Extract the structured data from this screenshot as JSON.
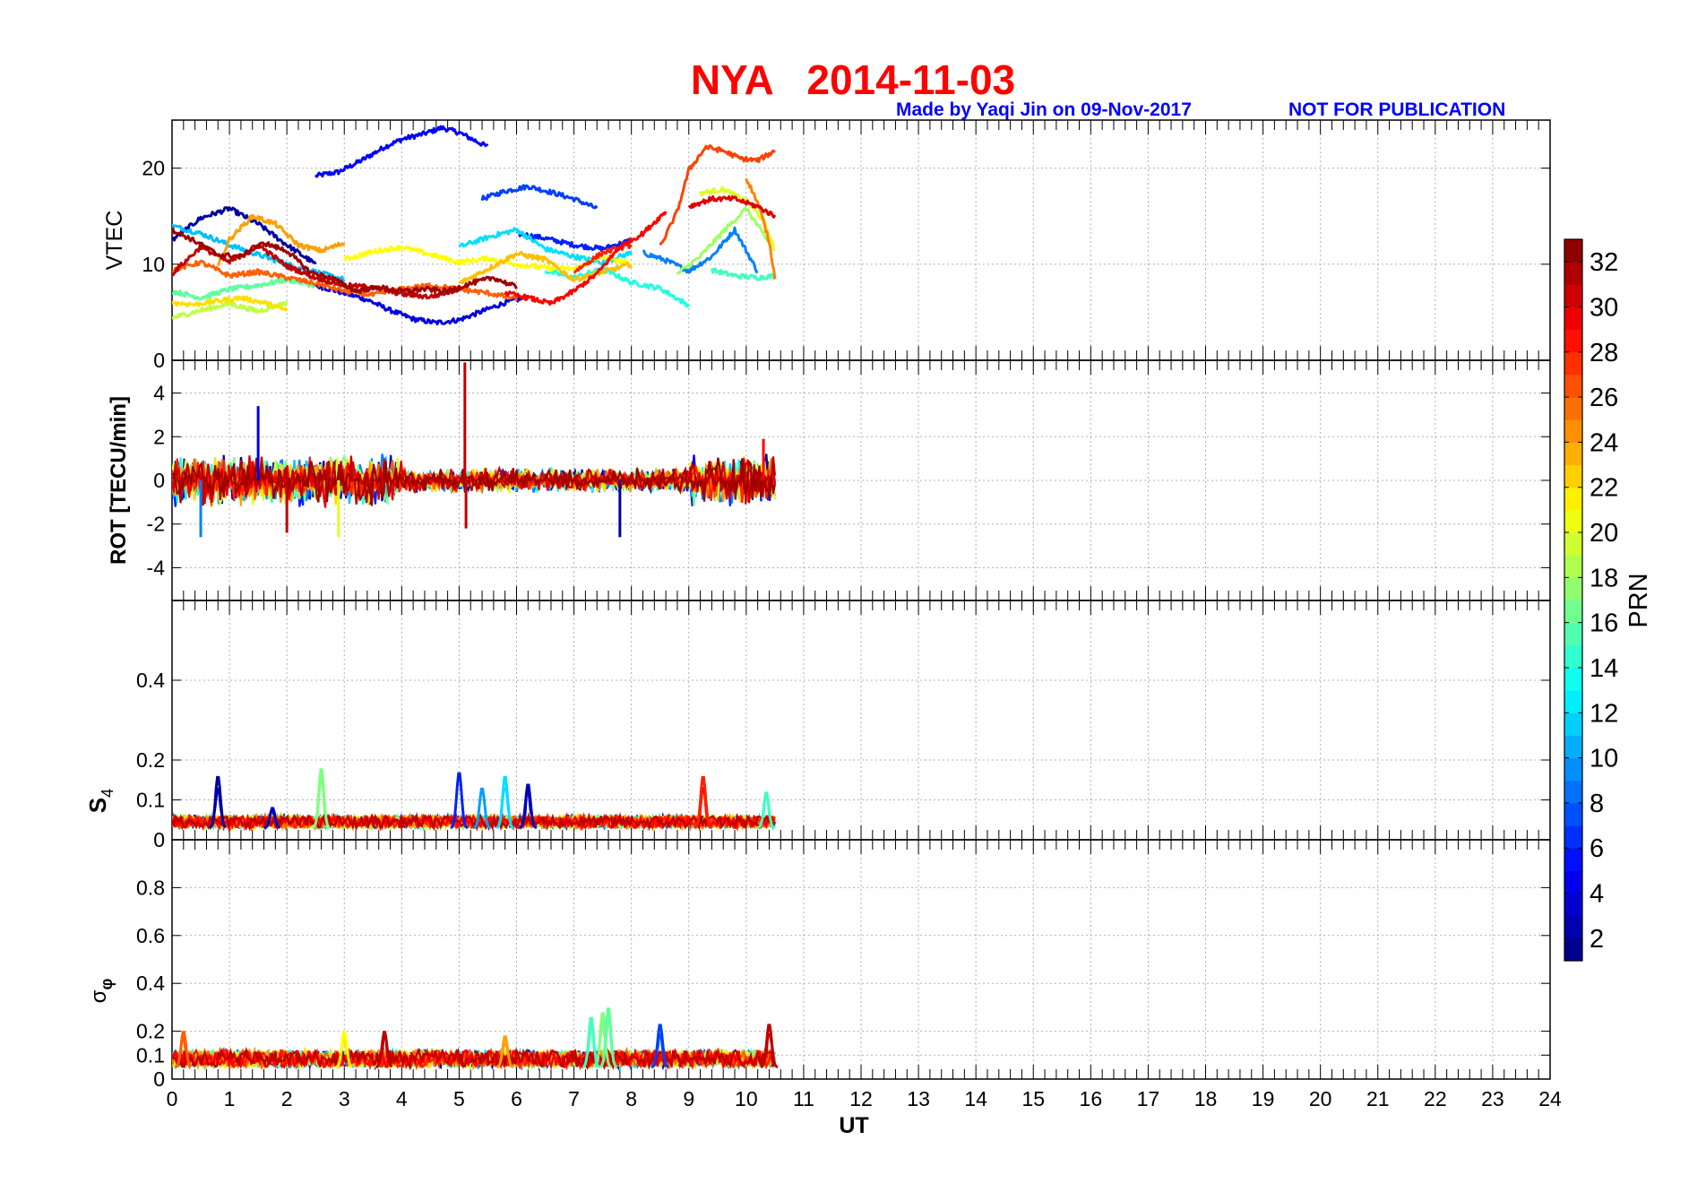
{
  "header": {
    "title": "NYA   2014-11-03",
    "credit": "Made by Yaqi Jin on 09-Nov-2017",
    "notice": "NOT FOR PUBLICATION"
  },
  "colors": {
    "title": "#ff0000",
    "credit": "#0000ff",
    "axis": "#000000",
    "grid": "#b0b0b0"
  },
  "chart_data": {
    "type": "line",
    "colormap": "jet",
    "x": {
      "label": "UT",
      "range": [
        0,
        24
      ],
      "ticks": [
        0,
        1,
        2,
        3,
        4,
        5,
        6,
        7,
        8,
        9,
        10,
        11,
        12,
        13,
        14,
        15,
        16,
        17,
        18,
        19,
        20,
        21,
        22,
        23,
        24
      ],
      "tick_labels": [
        "0",
        "1",
        "2",
        "3",
        "4",
        "5",
        "6",
        "7",
        "8",
        "9",
        "10",
        "11",
        "12",
        "13",
        "14",
        "15",
        "16",
        "17",
        "18",
        "19",
        "20",
        "21",
        "22",
        "23",
        "24"
      ],
      "data_coverage_ut": [
        0,
        10.5
      ]
    },
    "panels": [
      {
        "id": "vtec",
        "ylabel": "VTEC",
        "ylim": [
          0,
          25
        ],
        "ticks": [
          0,
          10,
          20
        ],
        "tick_labels": [
          "0",
          "10",
          "20"
        ],
        "series": [
          {
            "prn": 5,
            "x": [
              2.5,
              2.9,
              3.3,
              3.7,
              4.0,
              4.4,
              4.7,
              5.0,
              5.3,
              5.5
            ],
            "y": [
              19.2,
              19.6,
              20.8,
              22.2,
              23.0,
              23.6,
              24.2,
              23.7,
              22.8,
              22.2
            ]
          },
          {
            "prn": 4,
            "x": [
              2.5,
              3.0,
              3.4,
              3.8,
              4.2,
              4.6,
              5.0,
              5.4,
              5.8,
              6.2
            ],
            "y": [
              7.8,
              7.0,
              6.3,
              5.2,
              4.3,
              3.9,
              4.2,
              5.1,
              6.0,
              6.6
            ]
          },
          {
            "prn": 7,
            "x": [
              5.4,
              5.8,
              6.2,
              6.6,
              7.0,
              7.4
            ],
            "y": [
              16.8,
              17.6,
              18.1,
              17.5,
              16.8,
              15.8
            ]
          },
          {
            "prn": 6,
            "x": [
              6.0,
              6.5,
              7.0,
              7.5,
              8.0
            ],
            "y": [
              13.2,
              12.7,
              12.0,
              11.6,
              12.5
            ]
          },
          {
            "prn": 2,
            "x": [
              0,
              0.5,
              1.0,
              1.5,
              2.0,
              2.5
            ],
            "y": [
              12.5,
              14.8,
              15.8,
              14.2,
              12.0,
              10.0
            ]
          },
          {
            "prn": 9,
            "x": [
              8.2,
              8.6,
              9.0,
              9.4,
              9.8,
              10.2
            ],
            "y": [
              11.2,
              10.4,
              9.3,
              10.8,
              13.6,
              9.2
            ]
          },
          {
            "prn": 11,
            "x": [
              0,
              0.5,
              1.0,
              1.5,
              2.0,
              2.5,
              3.0
            ],
            "y": [
              14.0,
              13.2,
              12.0,
              11.0,
              10.0,
              9.2,
              8.4
            ]
          },
          {
            "prn": 12,
            "x": [
              5.0,
              5.5,
              6.0,
              6.5,
              7.0,
              7.5,
              8.0
            ],
            "y": [
              11.8,
              12.8,
              13.6,
              11.6,
              10.8,
              10.2,
              11.2
            ]
          },
          {
            "prn": 14,
            "x": [
              6.5,
              7.0,
              7.5,
              8.0,
              8.5,
              9.0
            ],
            "y": [
              9.3,
              8.6,
              9.5,
              8.1,
              7.5,
              5.7
            ]
          },
          {
            "prn": 15,
            "x": [
              9.4,
              9.8,
              10.2,
              10.5
            ],
            "y": [
              9.4,
              8.8,
              8.6,
              8.8
            ]
          },
          {
            "prn": 16,
            "x": [
              0,
              0.5,
              1.0,
              1.5,
              2.0,
              2.5
            ],
            "y": [
              7.2,
              6.5,
              7.4,
              7.8,
              8.4,
              7.8
            ]
          },
          {
            "prn": 18,
            "x": [
              8.8,
              9.2,
              9.6,
              10.0,
              10.4
            ],
            "y": [
              9.0,
              10.8,
              13.4,
              15.8,
              12.2
            ]
          },
          {
            "prn": 19,
            "x": [
              0,
              0.5,
              1.0,
              1.5,
              2.0
            ],
            "y": [
              4.4,
              5.2,
              5.9,
              5.1,
              6.0
            ]
          },
          {
            "prn": 20,
            "x": [
              9.2,
              9.6,
              10.0,
              10.3,
              10.5
            ],
            "y": [
              17.4,
              17.8,
              16.6,
              14.6,
              11.4
            ]
          },
          {
            "prn": 21,
            "x": [
              3.0,
              3.5,
              4.0,
              4.5,
              5.0,
              5.5,
              6.0,
              6.5,
              7.0,
              7.5,
              8.0
            ],
            "y": [
              10.5,
              11.3,
              11.8,
              11.0,
              10.2,
              10.6,
              10.0,
              9.6,
              9.5,
              10.8,
              10.0
            ]
          },
          {
            "prn": 22,
            "x": [
              0,
              0.4,
              0.8,
              1.2,
              1.6,
              2.0
            ],
            "y": [
              6.0,
              5.8,
              6.2,
              6.5,
              6.0,
              5.2
            ]
          },
          {
            "prn": 23,
            "x": [
              5.0,
              5.5,
              6.0,
              6.5,
              7.0,
              7.5,
              8.0
            ],
            "y": [
              8.0,
              9.5,
              11.1,
              10.5,
              8.4,
              9.2,
              10.0
            ]
          },
          {
            "prn": 24,
            "x": [
              0.8,
              1.0,
              1.4,
              1.8,
              2.2,
              2.6,
              3.0
            ],
            "y": [
              9.8,
              12.6,
              15.0,
              14.2,
              12.0,
              11.4,
              12.2
            ]
          },
          {
            "prn": 25,
            "x": [
              10.0,
              10.2,
              10.4,
              10.5
            ],
            "y": [
              19.0,
              16.4,
              12.4,
              8.6
            ]
          },
          {
            "prn": 26,
            "x": [
              0,
              0.5,
              1.0,
              1.5,
              2.0,
              2.5,
              3.0,
              3.5,
              4.0,
              4.5,
              5.0,
              5.5,
              6.0
            ],
            "y": [
              9.4,
              10.2,
              8.8,
              9.2,
              8.6,
              8.0,
              7.2,
              6.8,
              7.4,
              7.8,
              7.4,
              7.0,
              6.4
            ]
          },
          {
            "prn": 27,
            "x": [
              8.5,
              8.8,
              9.0,
              9.3,
              9.6,
              9.9,
              10.2,
              10.5
            ],
            "y": [
              11.8,
              15.5,
              19.8,
              22.2,
              21.8,
              21.0,
              20.8,
              21.8
            ]
          },
          {
            "prn": 28,
            "x": [
              7.0,
              7.5,
              8.0
            ],
            "y": [
              9.2,
              11.2,
              12.0
            ]
          },
          {
            "prn": 29,
            "x": [
              5.8,
              6.2,
              6.6,
              7.0,
              7.4,
              7.8,
              8.2,
              8.6
            ],
            "y": [
              7.0,
              6.5,
              5.9,
              7.2,
              9.0,
              11.8,
              13.2,
              15.5
            ]
          },
          {
            "prn": 30,
            "x": [
              9.0,
              9.4,
              9.8,
              10.2,
              10.5
            ],
            "y": [
              16.0,
              16.8,
              16.8,
              16.0,
              15.0
            ]
          },
          {
            "prn": 31,
            "x": [
              0,
              0.5,
              1.0,
              1.5,
              2.0,
              2.5,
              3.0,
              3.5,
              4.0,
              4.5,
              5.0
            ],
            "y": [
              9.0,
              11.8,
              10.2,
              12.0,
              9.8,
              8.6,
              7.8,
              7.6,
              6.9,
              6.6,
              7.4
            ]
          },
          {
            "prn": 32,
            "x": [
              0,
              0.4,
              0.8,
              1.2,
              1.6,
              2.0,
              2.4,
              2.8,
              3.2,
              3.6,
              4.0,
              4.4,
              4.8,
              5.2,
              5.6,
              6.0
            ],
            "y": [
              13.6,
              12.4,
              11.0,
              10.8,
              12.2,
              11.4,
              9.2,
              8.5,
              7.2,
              7.6,
              7.2,
              7.4,
              7.2,
              8.0,
              8.6,
              7.6
            ]
          }
        ]
      },
      {
        "id": "rot",
        "ylabel": "ROT [TECU/min]",
        "ylim": [
          -5.5,
          5.5
        ],
        "ticks": [
          -4,
          -2,
          0,
          2,
          4
        ],
        "tick_labels": [
          "-4",
          "-2",
          "0",
          "2",
          "4"
        ],
        "spikes": [
          {
            "prn": 31,
            "x": 5.1,
            "y": 5.4
          },
          {
            "prn": 31,
            "x": 5.12,
            "y": -2.2
          },
          {
            "prn": 4,
            "x": 1.5,
            "y": 3.4
          },
          {
            "prn": 9,
            "x": 0.5,
            "y": -2.6
          },
          {
            "prn": 2,
            "x": 7.8,
            "y": -2.6
          },
          {
            "prn": 20,
            "x": 2.9,
            "y": -2.6
          },
          {
            "prn": 31,
            "x": 2.0,
            "y": -2.4
          },
          {
            "prn": 29,
            "x": 10.3,
            "y": 1.9
          }
        ]
      },
      {
        "id": "s4",
        "ylabel": "S4",
        "ylim": [
          0,
          0.6
        ],
        "ticks": [
          0,
          0.1,
          0.2,
          0.4
        ],
        "tick_labels": [
          "0",
          "0.1",
          "0.2",
          "0.4"
        ],
        "baseline": [
          0.03,
          0.06
        ],
        "peaks": [
          {
            "prn": 2,
            "x": 0.8,
            "y": 0.16
          },
          {
            "prn": 17,
            "x": 2.6,
            "y": 0.18
          },
          {
            "prn": 6,
            "x": 5.0,
            "y": 0.17
          },
          {
            "prn": 10,
            "x": 5.4,
            "y": 0.13
          },
          {
            "prn": 12,
            "x": 5.8,
            "y": 0.16
          },
          {
            "prn": 3,
            "x": 6.2,
            "y": 0.14
          },
          {
            "prn": 28,
            "x": 9.25,
            "y": 0.16
          },
          {
            "prn": 15,
            "x": 10.35,
            "y": 0.12
          },
          {
            "prn": 3,
            "x": 1.75,
            "y": 0.08
          }
        ]
      },
      {
        "id": "sigma_phi",
        "ylabel": "σφ",
        "ylim": [
          0,
          1
        ],
        "ticks": [
          0,
          0.1,
          0.2,
          0.4,
          0.6,
          0.8
        ],
        "tick_labels": [
          "0",
          "0.1",
          "0.2",
          "0.4",
          "0.6",
          "0.8"
        ],
        "baseline": [
          0.05,
          0.12
        ],
        "peaks": [
          {
            "prn": 17,
            "x": 7.5,
            "y": 0.28
          },
          {
            "prn": 16,
            "x": 7.6,
            "y": 0.3
          },
          {
            "prn": 15,
            "x": 7.3,
            "y": 0.26
          },
          {
            "prn": 7,
            "x": 8.5,
            "y": 0.23
          },
          {
            "prn": 31,
            "x": 10.4,
            "y": 0.23
          },
          {
            "prn": 21,
            "x": 3.0,
            "y": 0.2
          },
          {
            "prn": 26,
            "x": 0.2,
            "y": 0.2
          },
          {
            "prn": 31,
            "x": 3.7,
            "y": 0.2
          },
          {
            "prn": 24,
            "x": 5.8,
            "y": 0.18
          }
        ]
      }
    ],
    "colorbar": {
      "label": "PRN",
      "range": [
        1,
        33
      ],
      "ticks": [
        2,
        4,
        6,
        8,
        10,
        12,
        14,
        16,
        18,
        20,
        22,
        24,
        26,
        28,
        30,
        32
      ],
      "tick_labels": [
        "2",
        "4",
        "6",
        "8",
        "10",
        "12",
        "14",
        "16",
        "18",
        "20",
        "22",
        "24",
        "26",
        "28",
        "30",
        "32"
      ]
    }
  }
}
